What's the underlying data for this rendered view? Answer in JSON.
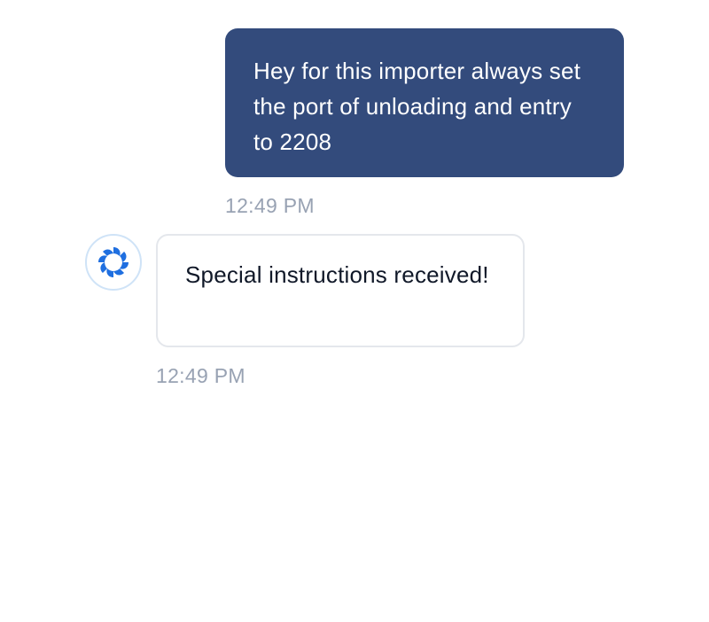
{
  "messages": [
    {
      "sender": "user",
      "text": "Hey for this importer always set the port of unloading and entry to 2208",
      "time": "12:49 PM"
    },
    {
      "sender": "bot",
      "text": "Special instructions received!",
      "time": "12:49 PM",
      "avatar_icon": "spiral-logo-icon"
    }
  ],
  "colors": {
    "user_bubble": "#334b7c",
    "user_text": "#ffffff",
    "bot_text": "#101828",
    "bot_border": "#e4e7ec",
    "timestamp": "#98a2b3",
    "logo_blue": "#1f6fe0"
  }
}
